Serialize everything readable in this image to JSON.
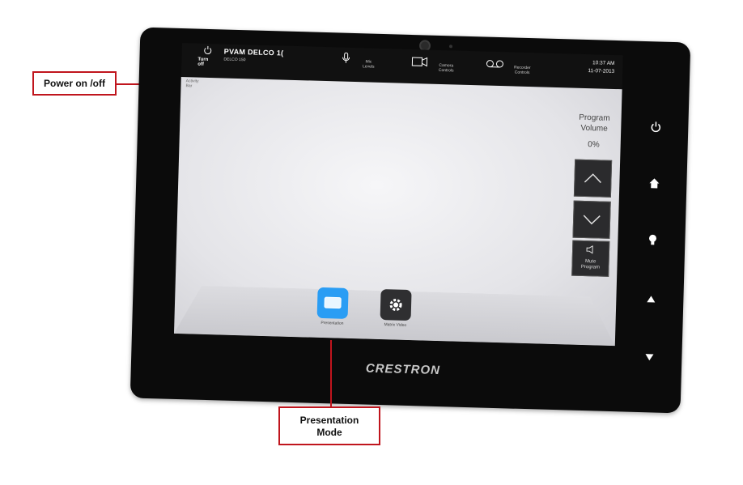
{
  "topbar": {
    "power_label": "Turn off",
    "room_title": "PVAM DELCO 1(",
    "room_subtitle": "DELCO 150",
    "mic_label": [
      "Mic",
      "Levels"
    ],
    "camera_label": [
      "Camera",
      "Controls"
    ],
    "recorder_label": [
      "Recorder",
      "Controls"
    ],
    "time": "10:37 AM",
    "date": "11-07-2013",
    "activity_label": [
      "Activity",
      "Bar"
    ]
  },
  "volume": {
    "title_line1": "Program",
    "title_line2": "Volume",
    "level": "0%",
    "mute_line1": "Mute",
    "mute_line2": "Program"
  },
  "sources": [
    {
      "label": "Presentation",
      "color": "#2a9df4"
    },
    {
      "label": "Matrix Video",
      "color": "#2f2f31"
    }
  ],
  "brand": "CRESTRON",
  "callouts": {
    "power": "Power on /off",
    "presentation_line1": "Presentation",
    "presentation_line2": "Mode"
  },
  "side_buttons": [
    "power-icon",
    "home-icon",
    "light-icon",
    "volume-up-icon",
    "volume-down-icon"
  ]
}
